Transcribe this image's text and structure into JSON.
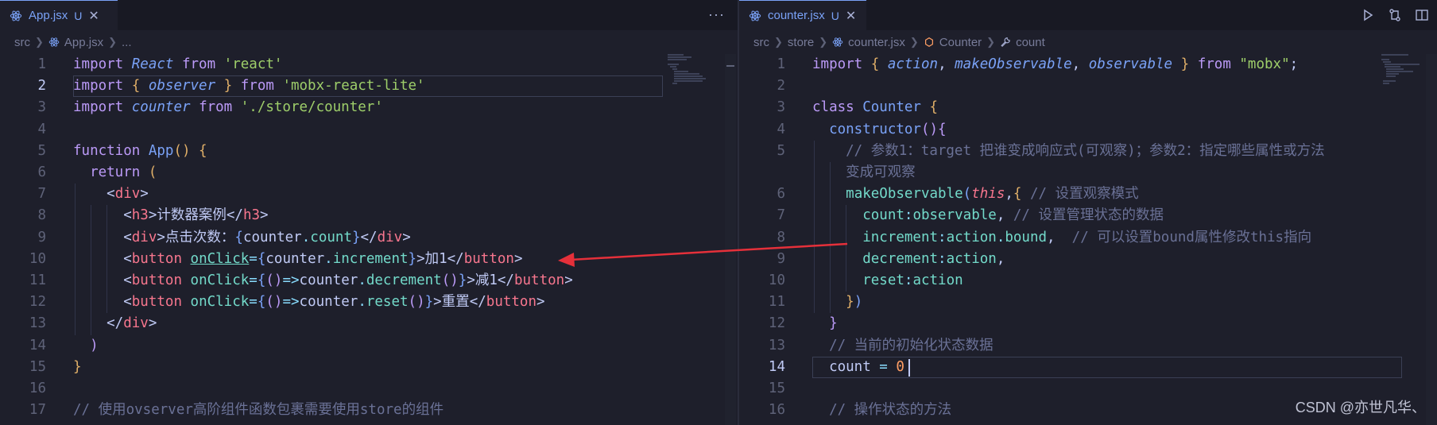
{
  "left": {
    "tab": {
      "name": "App.jsx",
      "status": "U",
      "close": "✕"
    },
    "more": "···",
    "breadcrumb": {
      "folder": "src",
      "file": "App.jsx",
      "tail": "..."
    },
    "active_line": 2,
    "lines": [
      {
        "n": "1",
        "tokens": [
          [
            "kw",
            "import "
          ],
          [
            "var",
            "React"
          ],
          [
            "kw",
            " from "
          ],
          [
            "str",
            "'react'"
          ]
        ]
      },
      {
        "n": "2",
        "tokens": [
          [
            "kw",
            "import "
          ],
          [
            "brk",
            "{ "
          ],
          [
            "var",
            "observer"
          ],
          [
            "brk",
            " }"
          ],
          [
            "kw",
            " from "
          ],
          [
            "str",
            "'mobx-react-lite'"
          ]
        ]
      },
      {
        "n": "3",
        "tokens": [
          [
            "kw",
            "import "
          ],
          [
            "var",
            "counter"
          ],
          [
            "kw",
            " from "
          ],
          [
            "str",
            "'./store/counter'"
          ]
        ]
      },
      {
        "n": "4",
        "tokens": []
      },
      {
        "n": "5",
        "tokens": [
          [
            "kw",
            "function "
          ],
          [
            "fn",
            "App"
          ],
          [
            "brk",
            "() {"
          ]
        ]
      },
      {
        "n": "6",
        "tokens": [
          [
            "txt",
            "  "
          ],
          [
            "kw",
            "return "
          ],
          [
            "brk",
            "("
          ]
        ]
      },
      {
        "n": "7",
        "tokens": [
          [
            "txt",
            "    <"
          ],
          [
            "tag",
            "div"
          ],
          [
            "txt",
            ">"
          ]
        ]
      },
      {
        "n": "8",
        "tokens": [
          [
            "txt",
            "      <"
          ],
          [
            "tag",
            "h3"
          ],
          [
            "txt",
            ">计数器案例</"
          ],
          [
            "tag",
            "h3"
          ],
          [
            "txt",
            ">"
          ]
        ]
      },
      {
        "n": "9",
        "tokens": [
          [
            "txt",
            "      <"
          ],
          [
            "tag",
            "div"
          ],
          [
            "txt",
            ">点击次数："
          ],
          [
            "fn",
            "{"
          ],
          [
            "txt",
            "counter"
          ],
          [
            "op",
            "."
          ],
          [
            "prop",
            "count"
          ],
          [
            "fn",
            "}"
          ],
          [
            "txt",
            "</"
          ],
          [
            "tag",
            "div"
          ],
          [
            "txt",
            ">"
          ]
        ]
      },
      {
        "n": "10",
        "tokens": [
          [
            "txt",
            "      <"
          ],
          [
            "tag",
            "button "
          ],
          [
            "prop ul",
            "onClick"
          ],
          [
            "op",
            "="
          ],
          [
            "fn",
            "{"
          ],
          [
            "txt",
            "counter"
          ],
          [
            "op",
            "."
          ],
          [
            "prop",
            "increment"
          ],
          [
            "fn",
            "}"
          ],
          [
            "txt",
            ">加1</"
          ],
          [
            "tag",
            "button"
          ],
          [
            "txt",
            ">"
          ]
        ]
      },
      {
        "n": "11",
        "tokens": [
          [
            "txt",
            "      <"
          ],
          [
            "tag",
            "button "
          ],
          [
            "prop",
            "onClick"
          ],
          [
            "op",
            "="
          ],
          [
            "fn",
            "{"
          ],
          [
            "kw",
            "()"
          ],
          [
            "op",
            "=>"
          ],
          [
            "txt",
            "counter"
          ],
          [
            "op",
            "."
          ],
          [
            "prop",
            "decrement"
          ],
          [
            "kw",
            "()"
          ],
          [
            "fn",
            "}"
          ],
          [
            "txt",
            ">减1</"
          ],
          [
            "tag",
            "button"
          ],
          [
            "txt",
            ">"
          ]
        ]
      },
      {
        "n": "12",
        "tokens": [
          [
            "txt",
            "      <"
          ],
          [
            "tag",
            "button "
          ],
          [
            "prop",
            "onClick"
          ],
          [
            "op",
            "="
          ],
          [
            "fn",
            "{"
          ],
          [
            "kw",
            "()"
          ],
          [
            "op",
            "=>"
          ],
          [
            "txt",
            "counter"
          ],
          [
            "op",
            "."
          ],
          [
            "prop",
            "reset"
          ],
          [
            "kw",
            "()"
          ],
          [
            "fn",
            "}"
          ],
          [
            "txt",
            ">重置</"
          ],
          [
            "tag",
            "button"
          ],
          [
            "txt",
            ">"
          ]
        ]
      },
      {
        "n": "13",
        "tokens": [
          [
            "txt",
            "    </"
          ],
          [
            "tag",
            "div"
          ],
          [
            "txt",
            ">"
          ]
        ]
      },
      {
        "n": "14",
        "tokens": [
          [
            "txt",
            "  "
          ],
          [
            "kw",
            ")"
          ]
        ]
      },
      {
        "n": "15",
        "tokens": [
          [
            "brk",
            "}"
          ]
        ]
      },
      {
        "n": "16",
        "tokens": []
      },
      {
        "n": "17",
        "tokens": [
          [
            "cmt",
            "// 使用ovserver高阶组件函数包裹需要使用store的组件"
          ]
        ]
      }
    ]
  },
  "right": {
    "tab": {
      "name": "counter.jsx",
      "status": "U",
      "close": "✕"
    },
    "breadcrumb": {
      "folder1": "src",
      "folder2": "store",
      "file": "counter.jsx",
      "class": "Counter",
      "symbol": "count"
    },
    "active_line": 14,
    "lines": [
      {
        "n": "1",
        "tokens": [
          [
            "kw",
            "import "
          ],
          [
            "brk",
            "{ "
          ],
          [
            "var",
            "action"
          ],
          [
            "txt",
            ", "
          ],
          [
            "var",
            "makeObservable"
          ],
          [
            "txt",
            ", "
          ],
          [
            "var",
            "observable"
          ],
          [
            "brk",
            " }"
          ],
          [
            "kw",
            " from "
          ],
          [
            "str",
            "\"mobx\""
          ],
          [
            "txt",
            ";"
          ]
        ]
      },
      {
        "n": "2",
        "tokens": []
      },
      {
        "n": "3",
        "tokens": [
          [
            "kw",
            "class "
          ],
          [
            "fn",
            "Counter "
          ],
          [
            "brk",
            "{"
          ]
        ]
      },
      {
        "n": "4",
        "tokens": [
          [
            "txt",
            "  "
          ],
          [
            "fn",
            "constructor"
          ],
          [
            "kw",
            "(){"
          ]
        ]
      },
      {
        "n": "5",
        "tokens": [
          [
            "cmt",
            "    // 参数1：target 把谁变成响应式(可观察)；参数2：指定哪些属性或方法"
          ]
        ]
      },
      {
        "n": "",
        "tokens": [
          [
            "cmt",
            "    变成可观察"
          ]
        ]
      },
      {
        "n": "6",
        "tokens": [
          [
            "txt",
            "    "
          ],
          [
            "prop",
            "makeObservable"
          ],
          [
            "fn",
            "("
          ],
          [
            "this",
            "this"
          ],
          [
            "txt",
            ","
          ],
          [
            "brk",
            "{ "
          ],
          [
            "cmt",
            "// 设置观察模式"
          ]
        ]
      },
      {
        "n": "7",
        "tokens": [
          [
            "txt",
            "      "
          ],
          [
            "prop",
            "count"
          ],
          [
            "op",
            ":"
          ],
          [
            "prop",
            "observable"
          ],
          [
            "txt",
            ", "
          ],
          [
            "cmt",
            "// 设置管理状态的数据"
          ]
        ]
      },
      {
        "n": "8",
        "tokens": [
          [
            "txt",
            "      "
          ],
          [
            "prop",
            "increment"
          ],
          [
            "op",
            ":"
          ],
          [
            "prop",
            "action"
          ],
          [
            "op",
            "."
          ],
          [
            "prop",
            "bound"
          ],
          [
            "txt",
            ",  "
          ],
          [
            "cmt",
            "// 可以设置bound属性修改this指向"
          ]
        ]
      },
      {
        "n": "9",
        "tokens": [
          [
            "txt",
            "      "
          ],
          [
            "prop",
            "decrement"
          ],
          [
            "op",
            ":"
          ],
          [
            "prop",
            "action"
          ],
          [
            "txt",
            ","
          ]
        ]
      },
      {
        "n": "10",
        "tokens": [
          [
            "txt",
            "      "
          ],
          [
            "prop",
            "reset"
          ],
          [
            "op",
            ":"
          ],
          [
            "prop",
            "action"
          ]
        ]
      },
      {
        "n": "11",
        "tokens": [
          [
            "txt",
            "    "
          ],
          [
            "brk",
            "}"
          ],
          [
            "fn",
            ")"
          ]
        ]
      },
      {
        "n": "12",
        "tokens": [
          [
            "txt",
            "  "
          ],
          [
            "kw",
            "}"
          ]
        ]
      },
      {
        "n": "13",
        "tokens": [
          [
            "cmt",
            "  // 当前的初始化状态数据"
          ]
        ]
      },
      {
        "n": "14",
        "tokens": [
          [
            "txt",
            "  "
          ],
          [
            "txt",
            "count "
          ],
          [
            "op",
            "= "
          ],
          [
            "num",
            "0"
          ]
        ]
      },
      {
        "n": "15",
        "tokens": []
      },
      {
        "n": "16",
        "tokens": [
          [
            "cmt",
            "  // 操作状态的方法"
          ]
        ]
      }
    ]
  },
  "watermark": "CSDN @亦世凡华、",
  "colors": {
    "bg": "#1e1f2b",
    "accent": "#7aa2f7",
    "arrow": "#e5303a"
  }
}
